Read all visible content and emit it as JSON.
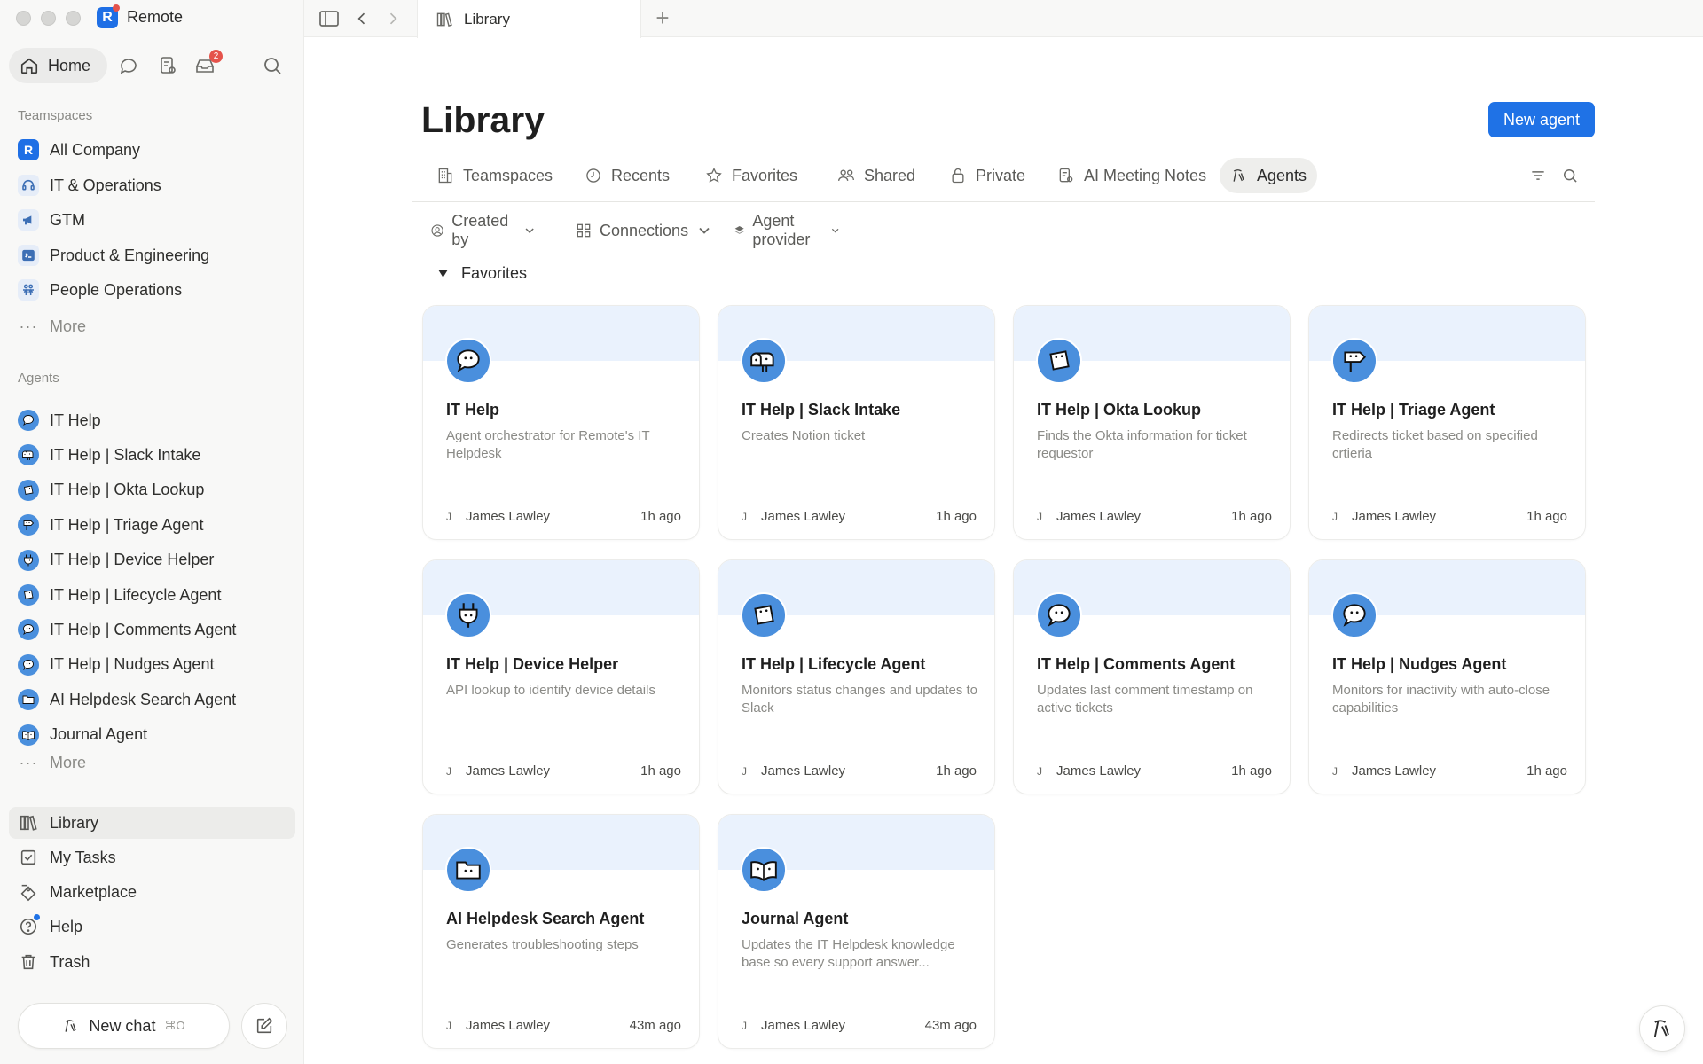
{
  "app": {
    "name": "Remote"
  },
  "sidebar": {
    "home_label": "Home",
    "inbox_badge": "2",
    "teamspaces_label": "Teamspaces",
    "teamspaces": [
      {
        "label": "All Company",
        "icon": "remote-logo-icon",
        "color": "#1f6fe5"
      },
      {
        "label": "IT & Operations",
        "icon": "headset-icon",
        "color": "#e8eef8"
      },
      {
        "label": "GTM",
        "icon": "megaphone-icon",
        "color": "#e8eef8"
      },
      {
        "label": "Product & Engineering",
        "icon": "terminal-icon",
        "color": "#e8eef8"
      },
      {
        "label": "People Operations",
        "icon": "people-icon",
        "color": "#e8eef8"
      }
    ],
    "teamspaces_more": "More",
    "agents_label": "Agents",
    "agents": [
      {
        "label": "IT Help",
        "icon": "speech-bubble-icon"
      },
      {
        "label": "IT Help | Slack Intake",
        "icon": "mailbox-icon"
      },
      {
        "label": "IT Help | Okta Lookup",
        "icon": "note-icon"
      },
      {
        "label": "IT Help | Triage Agent",
        "icon": "signpost-icon"
      },
      {
        "label": "IT Help | Device Helper",
        "icon": "plug-icon"
      },
      {
        "label": "IT Help | Lifecycle Agent",
        "icon": "note-icon"
      },
      {
        "label": "IT Help | Comments Agent",
        "icon": "speech-bubble-icon"
      },
      {
        "label": "IT Help | Nudges Agent",
        "icon": "speech-bubble-icon"
      },
      {
        "label": "AI Helpdesk Search Agent",
        "icon": "folder-icon"
      },
      {
        "label": "Journal Agent",
        "icon": "book-icon"
      }
    ],
    "agents_more": "More",
    "bottom": [
      {
        "label": "Library",
        "icon": "library-icon",
        "active": true
      },
      {
        "label": "My Tasks",
        "icon": "checkbox-icon",
        "active": false
      },
      {
        "label": "Marketplace",
        "icon": "marketplace-icon",
        "active": false
      },
      {
        "label": "Help",
        "icon": "help-icon",
        "active": false
      },
      {
        "label": "Trash",
        "icon": "trash-icon",
        "active": false
      }
    ],
    "new_chat_label": "New chat",
    "new_chat_shortcut": "⌘O"
  },
  "tabbar": {
    "tab_title": "Library"
  },
  "main": {
    "title": "Library",
    "new_agent_label": "New agent",
    "tabs": [
      {
        "label": "Teamspaces",
        "icon": "building-icon"
      },
      {
        "label": "Recents",
        "icon": "clock-icon"
      },
      {
        "label": "Favorites",
        "icon": "star-icon"
      },
      {
        "label": "Shared",
        "icon": "shared-people-icon"
      },
      {
        "label": "Private",
        "icon": "lock-icon"
      },
      {
        "label": "AI Meeting Notes",
        "icon": "meeting-notes-icon"
      },
      {
        "label": "Agents",
        "icon": "agent-icon"
      }
    ],
    "active_tab": "Agents",
    "filters": [
      {
        "label": "Created by",
        "icon": "person-circle-icon"
      },
      {
        "label": "Connections",
        "icon": "grid-icon"
      },
      {
        "label": "Agent provider",
        "icon": "layers-icon"
      }
    ],
    "favorites_label": "Favorites",
    "cards": [
      {
        "title": "IT Help",
        "desc": "Agent orchestrator for Remote's IT Helpdesk",
        "author": "James Lawley",
        "author_initial": "J",
        "time": "1h ago",
        "icon": "speech-bubble-icon"
      },
      {
        "title": "IT Help | Slack Intake",
        "desc": "Creates Notion ticket",
        "author": "James Lawley",
        "author_initial": "J",
        "time": "1h ago",
        "icon": "mailbox-icon"
      },
      {
        "title": "IT Help | Okta Lookup",
        "desc": "Finds the Okta information for ticket requestor",
        "author": "James Lawley",
        "author_initial": "J",
        "time": "1h ago",
        "icon": "note-icon"
      },
      {
        "title": "IT Help | Triage Agent",
        "desc": "Redirects ticket based on specified crtieria",
        "author": "James Lawley",
        "author_initial": "J",
        "time": "1h ago",
        "icon": "signpost-icon"
      },
      {
        "title": "IT Help | Device Helper",
        "desc": "API lookup to identify device details",
        "author": "James Lawley",
        "author_initial": "J",
        "time": "1h ago",
        "icon": "plug-icon"
      },
      {
        "title": "IT Help | Lifecycle Agent",
        "desc": "Monitors status changes and updates to Slack",
        "author": "James Lawley",
        "author_initial": "J",
        "time": "1h ago",
        "icon": "note-icon"
      },
      {
        "title": "IT Help | Comments Agent",
        "desc": "Updates last comment timestamp on active tickets",
        "author": "James Lawley",
        "author_initial": "J",
        "time": "1h ago",
        "icon": "speech-bubble-icon"
      },
      {
        "title": "IT Help | Nudges Agent",
        "desc": "Monitors for inactivity with auto-close capabilities",
        "author": "James Lawley",
        "author_initial": "J",
        "time": "1h ago",
        "icon": "speech-bubble-icon"
      },
      {
        "title": "AI Helpdesk Search Agent",
        "desc": "Generates troubleshooting steps",
        "author": "James Lawley",
        "author_initial": "J",
        "time": "43m ago",
        "icon": "folder-icon"
      },
      {
        "title": "Journal Agent",
        "desc": "Updates the IT Helpdesk knowledge base so every support answer...",
        "author": "James Lawley",
        "author_initial": "J",
        "time": "43m ago",
        "icon": "book-icon"
      }
    ]
  },
  "colors": {
    "accent": "#1f72e6",
    "agent_icon_bg": "#4a8fdd",
    "card_band": "#eaf2fd"
  }
}
